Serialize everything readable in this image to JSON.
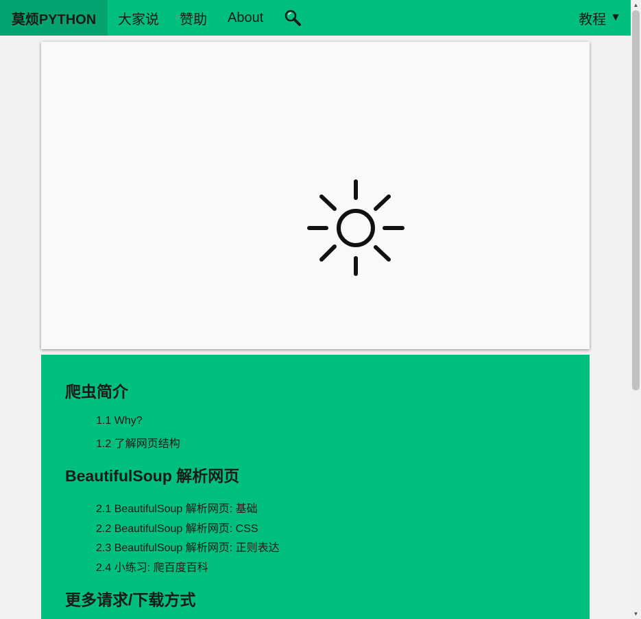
{
  "nav": {
    "brand": "莫烦PYTHON",
    "links": [
      "大家说",
      "赞助",
      "About"
    ],
    "tutorial_label": "教程",
    "tutorial_caret": "▼",
    "search_icon": "search-icon"
  },
  "hero": {
    "icon": "sun-icon"
  },
  "toc": {
    "sections": [
      {
        "title": "爬虫简介",
        "items": [
          "1.1 Why?",
          "1.2 了解网页结构"
        ]
      },
      {
        "title": "BeautifulSoup 解析网页",
        "items": [
          "2.1 BeautifulSoup 解析网页: 基础",
          "2.2 BeautifulSoup 解析网页: CSS",
          "2.3 BeautifulSoup 解析网页: 正则表达",
          "2.4 小练习: 爬百度百科"
        ]
      },
      {
        "title": "更多请求/下载方式",
        "items": []
      }
    ]
  },
  "colors": {
    "accent": "#00bf7f",
    "brand_bg": "#05a36f",
    "text": "#1a1a1a"
  },
  "scrollbar": {
    "up_arrow": "▲",
    "down_arrow": "▼"
  }
}
